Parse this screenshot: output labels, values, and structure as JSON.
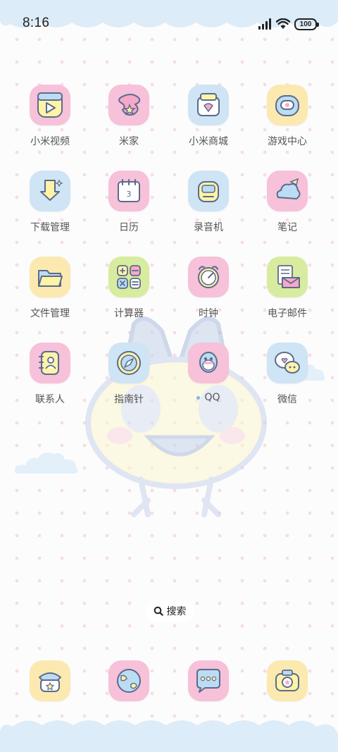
{
  "status_bar": {
    "time": "8:16",
    "battery": "100"
  },
  "apps": [
    {
      "label": "小米视频",
      "icon": "video-icon"
    },
    {
      "label": "米家",
      "icon": "home-icon"
    },
    {
      "label": "小米商城",
      "icon": "shop-icon"
    },
    {
      "label": "游戏中心",
      "icon": "game-icon"
    },
    {
      "label": "下载管理",
      "icon": "download-icon"
    },
    {
      "label": "日历",
      "icon": "calendar-icon",
      "calendar_day": "3"
    },
    {
      "label": "录音机",
      "icon": "recorder-icon"
    },
    {
      "label": "笔记",
      "icon": "notes-icon"
    },
    {
      "label": "文件管理",
      "icon": "folder-icon"
    },
    {
      "label": "计算器",
      "icon": "calculator-icon"
    },
    {
      "label": "时钟",
      "icon": "clock-icon"
    },
    {
      "label": "电子邮件",
      "icon": "mail-icon"
    },
    {
      "label": "联系人",
      "icon": "contacts-icon"
    },
    {
      "label": "指南针",
      "icon": "compass-icon"
    },
    {
      "label": "QQ",
      "icon": "qq-icon"
    },
    {
      "label": "微信",
      "icon": "wechat-icon"
    }
  ],
  "search": {
    "label": "搜索"
  },
  "dock": [
    {
      "icon": "phone-icon"
    },
    {
      "icon": "browser-icon"
    },
    {
      "icon": "messages-icon"
    },
    {
      "icon": "camera-icon"
    }
  ],
  "colors": {
    "pink_tile": "#f6c1d9",
    "blue_tile": "#cfe4f5",
    "yellow_tile": "#fbe9b0",
    "green_tile": "#d7ec9f",
    "outline": "#5b6b8c"
  }
}
